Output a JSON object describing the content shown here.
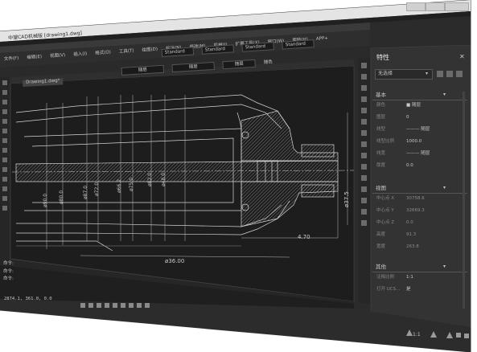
{
  "window": {
    "title_prefix": "中望CAD机械版",
    "file_name": "[drawing1.dwg]",
    "controls": [
      "minimize-icon",
      "maximize-icon",
      "close-icon"
    ]
  },
  "menubar": {
    "items": [
      "文件(F)",
      "编辑(E)",
      "视图(V)",
      "插入(I)",
      "格式(O)",
      "工具(T)",
      "绘图(D)",
      "标注(N)",
      "修改(M)",
      "机械(J)",
      "扩展工具(X)",
      "窗口(W)",
      "帮助(H)",
      "APP+"
    ]
  },
  "toolbar": {
    "style_dropdowns": [
      "Standard",
      "Standard",
      "Standard",
      "Standard"
    ],
    "layer_row": [
      "随层",
      "随层",
      "随层",
      "随色"
    ]
  },
  "doc_tab": {
    "label": "Drawing1.dwg*"
  },
  "drawing": {
    "dims_vertical": [
      "ø90.0",
      "ø80.0",
      "ø87.0",
      "ø72.0",
      "ø66.2",
      "ø75.0",
      "ø82.0",
      "ø48.0",
      "ø37.5"
    ],
    "dim_bottom": "ø36.00",
    "dim_right_h": "4.70"
  },
  "command_area": {
    "lines": [
      "命令:",
      "命令:",
      "命令:"
    ],
    "coords": "2874.1, 361.0, 0.0"
  },
  "statusbar": {
    "icons": [
      "snap-icon",
      "grid-icon",
      "ortho-icon",
      "polar-icon",
      "osnap-icon",
      "otrack-icon",
      "lineweight-icon",
      "model-icon"
    ],
    "scale": "1:1"
  },
  "properties": {
    "title": "特性",
    "selection": "无选择",
    "sections": [
      {
        "name": "基本",
        "rows": [
          {
            "label": "颜色",
            "value": "■ 随层"
          },
          {
            "label": "图层",
            "value": "0"
          },
          {
            "label": "线型",
            "value": "——— 随层"
          },
          {
            "label": "线型比例",
            "value": "1000.0"
          },
          {
            "label": "线宽",
            "value": "——— 随层"
          },
          {
            "label": "厚度",
            "value": "0.0"
          }
        ]
      },
      {
        "name": "视图",
        "rows": [
          {
            "label": "中心点 X",
            "value": "30758.6"
          },
          {
            "label": "中心点 Y",
            "value": "32669.3"
          },
          {
            "label": "中心点 Z",
            "value": "0.0"
          },
          {
            "label": "高度",
            "value": "91.3"
          },
          {
            "label": "宽度",
            "value": "263.8"
          }
        ]
      },
      {
        "name": "其他",
        "rows": [
          {
            "label": "注释比例",
            "value": "1:1"
          },
          {
            "label": "打开 UCS...",
            "value": "是"
          }
        ]
      }
    ]
  },
  "colors": {
    "frame": "#2b2b2b",
    "canvas": "#212121",
    "panel": "#333333",
    "line": "#d8d8d8"
  }
}
